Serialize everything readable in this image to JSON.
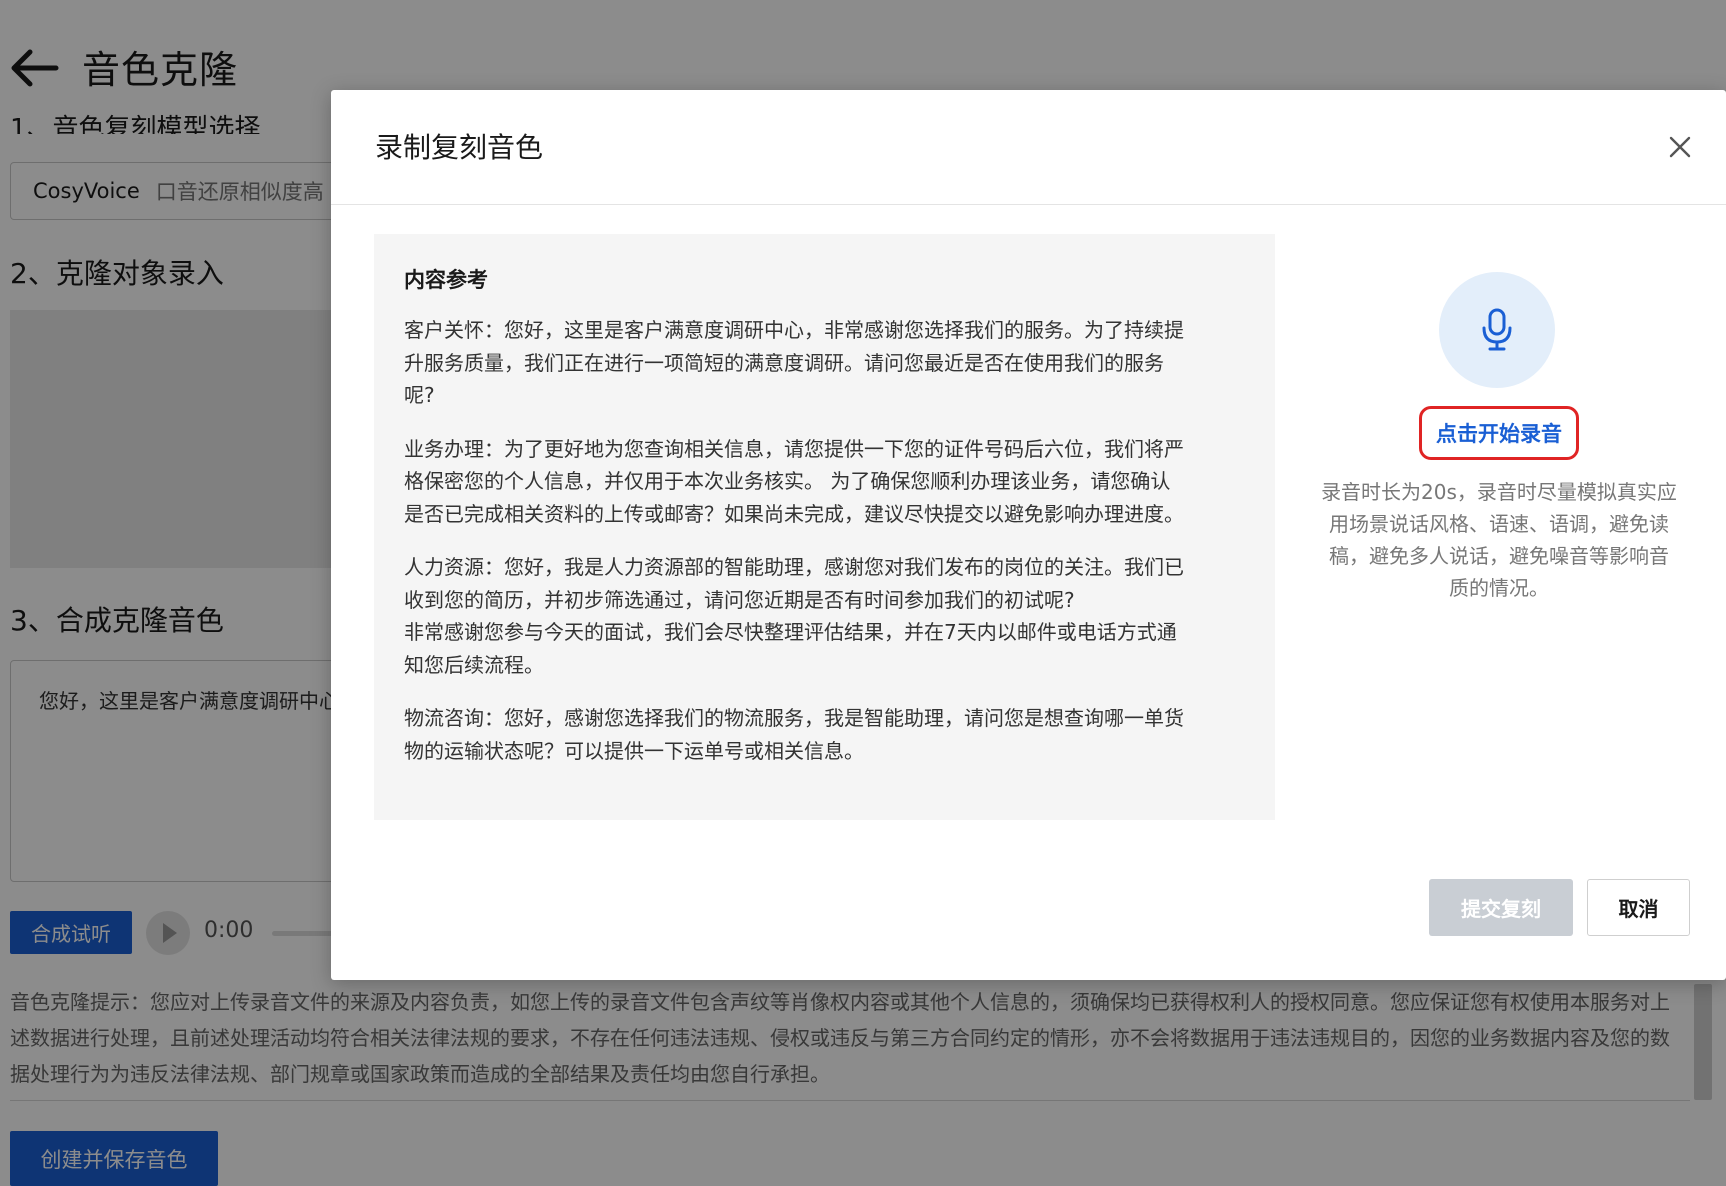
{
  "page": {
    "title": "音色克隆",
    "section1_heading": "1、音色复刻模型选择",
    "model_select": {
      "name": "CosyVoice",
      "description": "口音还原相似度高"
    },
    "section2_heading": "2、克隆对象录入",
    "section3_heading": "3、合成克隆音色",
    "synth_text": "您好，这里是客户满意度调研中心",
    "synth_button": "合成试听",
    "player_time": "0:00",
    "disclaimer": "音色克隆提示：您应对上传录音文件的来源及内容负责，如您上传的录音文件包含声纹等肖像权内容或其他个人信息的，须确保均已获得权利人的授权同意。您应保证您有权使用本服务对上述数据进行处理，且前述处理活动均符合相关法律法规的要求，不存在任何违法违规、侵权或违反与第三方合同约定的情形，亦不会将数据用于违法违规目的，因您的业务数据内容及您的数据处理行为为违反法律法规、部门规章或国家政策而造成的全部结果及责任均由您自行承担。",
    "create_button": "创建并保存音色"
  },
  "modal": {
    "title": "录制复刻音色",
    "reference": {
      "title": "内容参考",
      "paragraphs": [
        [
          "客户关怀：您好，这里是客户满意度调研中心，非常感谢您选择我们的服务。为了持续提",
          "升服务质量，我们正在进行一项简短的满意度调研。请问您最近是否在使用我们的服务",
          "呢?"
        ],
        [
          "业务办理：为了更好地为您查询相关信息，请您提供一下您的证件号码后六位，我们将严",
          "格保密您的个人信息，并仅用于本次业务核实。 为了确保您顺利办理该业务，请您确认",
          "是否已完成相关资料的上传或邮寄？如果尚未完成，建议尽快提交以避免影响办理进度。"
        ],
        [
          "人力资源：您好，我是人力资源部的智能助理，感谢您对我们发布的岗位的关注。我们已",
          "收到您的简历，并初步筛选通过，请问您近期是否有时间参加我们的初试呢?",
          "非常感谢您参与今天的面试，我们会尽快整理评估结果，并在7天内以邮件或电话方式通",
          "知您后续流程。"
        ],
        [
          "物流咨询：您好，感谢您选择我们的物流服务，我是智能助理，请问您是想查询哪一单货",
          "物的运输状态呢？可以提供一下运单号或相关信息。"
        ]
      ]
    },
    "record_button": "点击开始录音",
    "record_tip": [
      "录音时长为20s，录音时尽量模拟真实应",
      "用场景说话风格、语速、语调，避免读",
      "稿，避免多人说话，避免噪音等影响音",
      "质的情况。"
    ],
    "submit_button": "提交复刻",
    "cancel_button": "取消"
  },
  "colors": {
    "primary": "#1a5fd4",
    "highlight_border": "#e02424",
    "overlay": "rgba(0,0,0,0.45)",
    "mic_bg": "#e3eefa",
    "disabled_btn": "#c9ced4"
  },
  "icons": {
    "back": "arrow-left-icon",
    "close": "close-icon",
    "mic": "microphone-icon",
    "play": "play-icon"
  }
}
